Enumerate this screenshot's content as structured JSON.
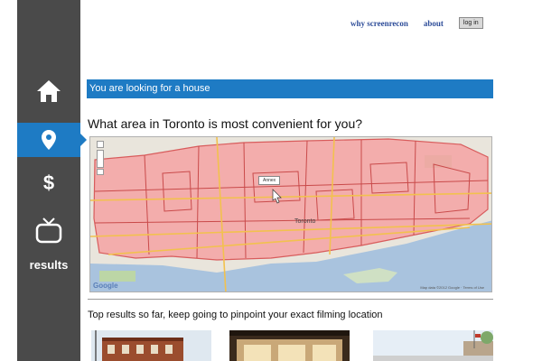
{
  "nav": {
    "why": "why screenrecon",
    "about": "about",
    "login": "log in"
  },
  "sidebar": {
    "items": [
      {
        "icon": "home-icon",
        "active": false
      },
      {
        "icon": "location-pin-icon",
        "active": true
      },
      {
        "icon": "dollar-icon",
        "active": false
      },
      {
        "icon": "tv-icon",
        "active": false
      }
    ],
    "results_label": "results"
  },
  "banner": "You are looking for a house",
  "question": "What area in Toronto is most convenient for you?",
  "map": {
    "tooltip": "Annex",
    "google": "Google",
    "copyright": "Map data ©2012 Google · Terms of Use",
    "labels": [
      "Toronto"
    ]
  },
  "results": {
    "heading": "Top results so far, keep going to pinpoint your exact filming location",
    "thumbnails": [
      "house-photo-1",
      "house-photo-2",
      "house-photo-3"
    ]
  },
  "colors": {
    "sidebar": "#4a4a4a",
    "accent": "#1e7bc4",
    "nav_link": "#2e4d99",
    "map_highlight": "#f4a3a3"
  }
}
